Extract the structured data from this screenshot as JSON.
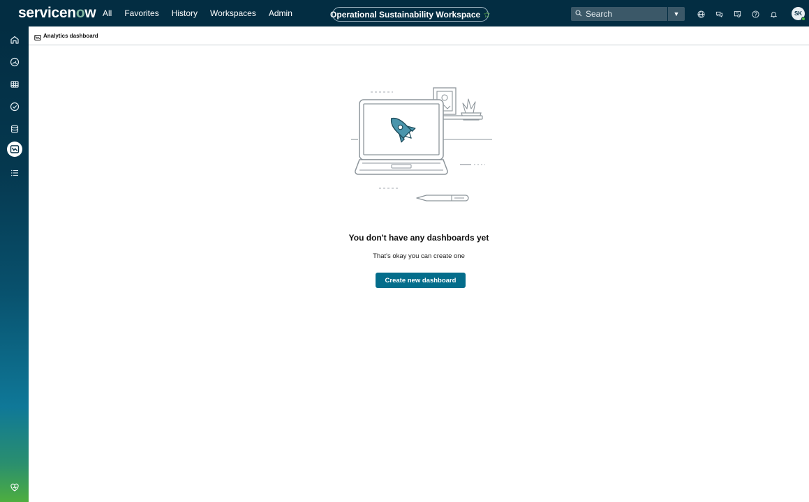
{
  "header": {
    "logo_text_left": "servicen",
    "logo_text_o": "o",
    "logo_text_right": "w",
    "nav": [
      "All",
      "Favorites",
      "History",
      "Workspaces",
      "Admin"
    ],
    "workspace": "Operational Sustainability Workspace",
    "workspace_star": "☆",
    "search_placeholder": "Search",
    "avatar_initials": "SK"
  },
  "icons": {
    "top": [
      "globe-icon",
      "chat-icon",
      "scan-icon",
      "help-icon",
      "bell-icon"
    ],
    "sidebar": [
      "home-icon",
      "gauge-icon",
      "table-icon",
      "check-circle-icon",
      "database-icon",
      "analytics-icon",
      "list-icon",
      "eco-icon"
    ]
  },
  "breadcrumb": {
    "label": "Analytics dashboard"
  },
  "empty_state": {
    "title": "You don't have any dashboards yet",
    "subtitle": "That's okay you can create one",
    "button": "Create new dashboard"
  },
  "colors": {
    "header_bg": "#032d42",
    "primary_button": "#046d8b",
    "accent_green": "#81b5a1",
    "illustration_teal": "#4a95ac"
  }
}
